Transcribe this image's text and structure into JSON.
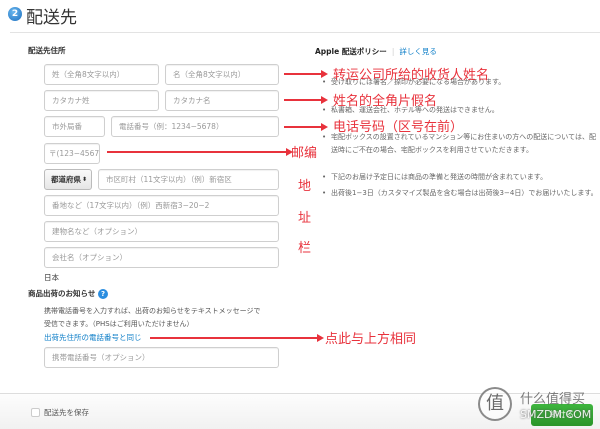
{
  "header": {
    "step": "2",
    "title": "配送先"
  },
  "form": {
    "section_label": "配送先住所",
    "last_name": "姓（全角8文字以内）",
    "first_name": "名（全角8文字以内）",
    "kana_last": "カタカナ姓",
    "kana_first": "カタカナ名",
    "area_code": "市外局番",
    "phone": "電話番号（例：1234−5678）",
    "postal": "〒(123−4567)",
    "prefecture": "都道府県",
    "city": "市区町村（11文字以内）（例）新宿区",
    "street": "番地など（17文字以内）（例）西新宿3−20−2",
    "building": "建物名など（オプション）",
    "company": "会社名（オプション）",
    "country": "日本"
  },
  "notify": {
    "title": "商品出荷のお知らせ",
    "desc1": "携帯電話番号を入力すれば、出荷のお知らせをテキストメッセージで",
    "desc2": "受信できます。（PHSはご利用いただけません）",
    "link": "出荷先住所の電話番号と同じ",
    "mobile": "携帯電話番号（オプション）"
  },
  "policy": {
    "title": "Apple 配送ポリシー",
    "link": "詳しく見る",
    "bullets": [
      "受け取りには署名／捺印が必要になる場合があります。",
      "私書箱、運送会社、ホテル等への発送はできません。",
      "宅配ボックスの設置されているマンション等にお住まいの方への配送については、配送時にご不在の場合、宅配ボックスを利用させていただきます。",
      "下記のお届け予定日には商品の準備と発送の時間が含まれています。",
      "出荷後1−3日（カスタマイズ製品を含む場合は出荷後3−4日）でお届けいたします。"
    ]
  },
  "annotations": {
    "name": "转运公司所给的收货人姓名",
    "kana": "姓名的全角片假名",
    "phone": "电话号码（区号在前）",
    "postal": "邮编",
    "addr1": "地",
    "addr2": "址",
    "addr3": "栏",
    "same": "点此与上方相同"
  },
  "footer": {
    "save": "配送先を保存",
    "continue": "続ける"
  },
  "watermark": {
    "text": "什么值得买",
    "sub": "SMZDM.COM"
  },
  "colors": {
    "accent": "#0f7fc8",
    "annotation": "#e8323c",
    "button": "#2e9f2e"
  }
}
